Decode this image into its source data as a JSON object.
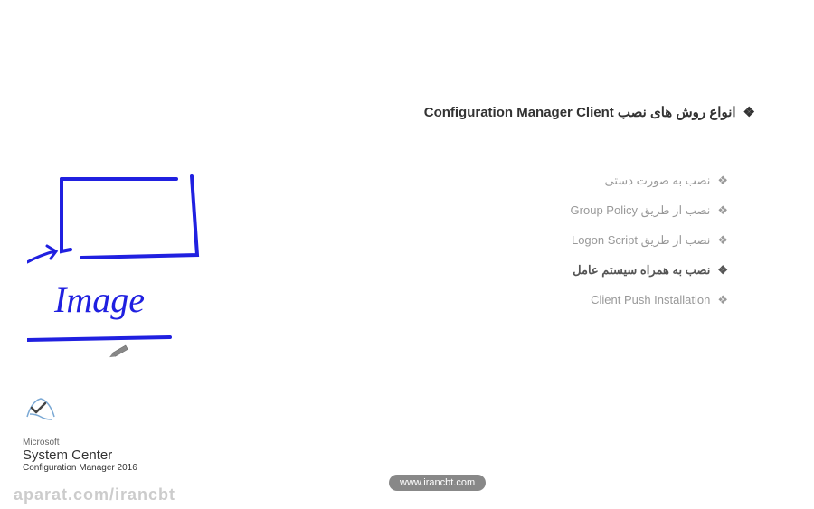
{
  "title": "انواع روش های نصب Configuration Manager Client",
  "items": [
    {
      "label": "نصب به صورت دستی",
      "highlighted": false
    },
    {
      "label": "نصب از طریق Group Policy",
      "highlighted": false
    },
    {
      "label": "نصب از طریق Logon Script",
      "highlighted": false
    },
    {
      "label": "نصب به همراه سیستم عامل",
      "highlighted": true
    },
    {
      "label": "Client Push Installation",
      "highlighted": false
    }
  ],
  "handwriting": {
    "text": "Image"
  },
  "branding": {
    "line1": "Microsoft",
    "line2": "System Center",
    "line3": "Configuration Manager 2016"
  },
  "url": "www.irancbt.com",
  "watermark": "aparat.com/irancbt"
}
